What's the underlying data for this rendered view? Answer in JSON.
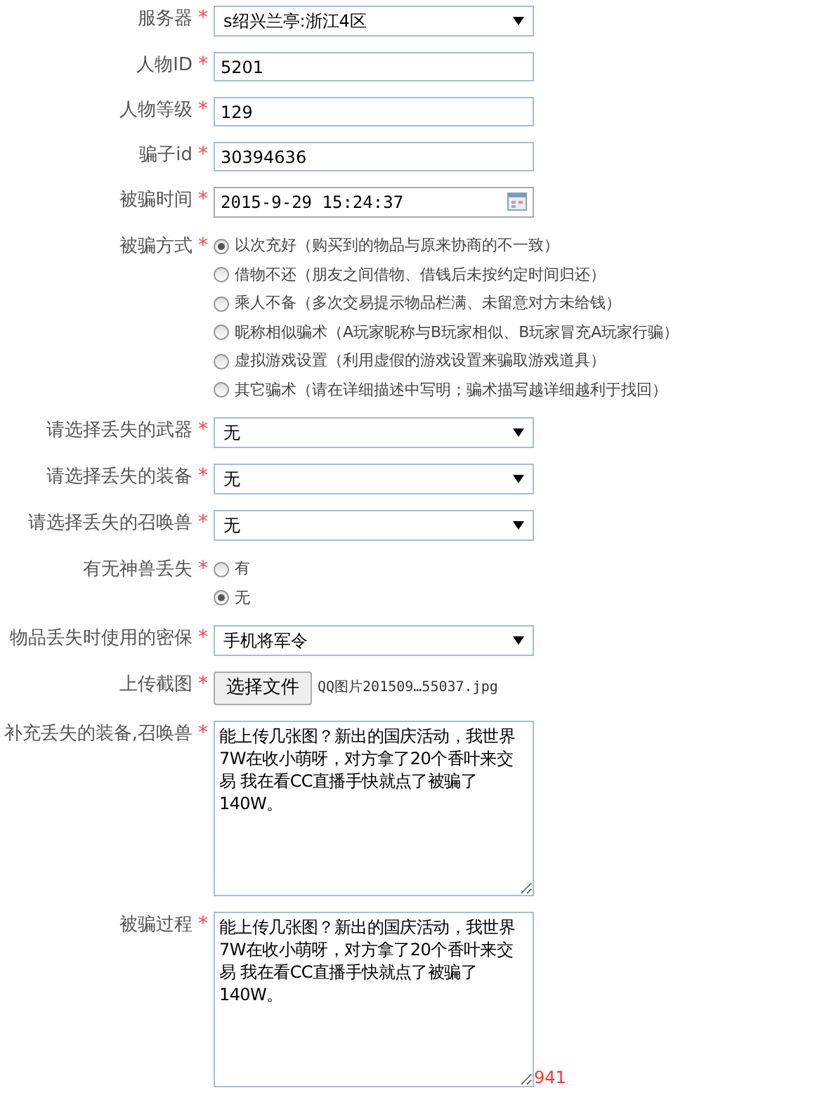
{
  "form": {
    "fields": [
      {
        "kind": "select",
        "label": "服务器",
        "mark": "*",
        "value": "s绍兴兰亭:浙江4区"
      },
      {
        "kind": "text",
        "label": "人物ID",
        "mark": "*",
        "value": "5201"
      },
      {
        "kind": "text",
        "label": "人物等级",
        "mark": "*",
        "value": "129"
      },
      {
        "kind": "text",
        "label": "骗子id",
        "mark": "*",
        "value": "30394636"
      },
      {
        "kind": "datetime",
        "label": "被骗时间",
        "mark": "*",
        "value": "2015-9-29 15:24:37"
      },
      {
        "kind": "radio",
        "label": "被骗方式",
        "mark": "*",
        "options": [
          {
            "label": "以次充好（购买到的物品与原来协商的不一致）",
            "selected": true
          },
          {
            "label": "借物不还（朋友之间借物、借钱后未按约定时间归还）",
            "selected": false
          },
          {
            "label": "乘人不备（多次交易提示物品栏满、未留意对方未给钱）",
            "selected": false
          },
          {
            "label": "昵称相似骗术（A玩家昵称与B玩家相似、B玩家冒充A玩家行骗）",
            "selected": false
          },
          {
            "label": "虚拟游戏设置（利用虚假的游戏设置来骗取游戏道具）",
            "selected": false
          },
          {
            "label": "其它骗术（请在详细描述中写明；骗术描写越详细越利于找回）",
            "selected": false
          }
        ]
      },
      {
        "kind": "select",
        "label": "请选择丢失的武器",
        "mark": "*",
        "value": "无"
      },
      {
        "kind": "select",
        "label": "请选择丢失的装备",
        "mark": "*",
        "value": "无"
      },
      {
        "kind": "select",
        "label": "请选择丢失的召唤兽",
        "mark": "*",
        "value": "无"
      },
      {
        "kind": "radio",
        "label": "有无神兽丢失",
        "mark": "*",
        "options": [
          {
            "label": "有",
            "selected": false
          },
          {
            "label": "无",
            "selected": true
          }
        ]
      },
      {
        "kind": "select",
        "label": "物品丢失时使用的密保",
        "mark": "*",
        "value": "手机将军令"
      },
      {
        "kind": "file",
        "label": "上传截图",
        "mark": "*",
        "button": "选择文件",
        "value": "QQ图片201509…55037.jpg"
      },
      {
        "kind": "textarea",
        "label": "补充丢失的装备,召唤兽",
        "mark": "*",
        "value": "能上传几张图？新出的国庆活动，我世界7W在收小萌呀，对方拿了20个香叶来交易 我在看CC直播手快就点了被骗了140W。"
      },
      {
        "kind": "textarea",
        "label": "被骗过程",
        "mark": "*",
        "value": "能上传几张图？新出的国庆活动，我世界7W在收小萌呀，对方拿了20个香叶来交易 我在看CC直播手快就点了被骗了140W。",
        "counter": "941"
      }
    ]
  }
}
